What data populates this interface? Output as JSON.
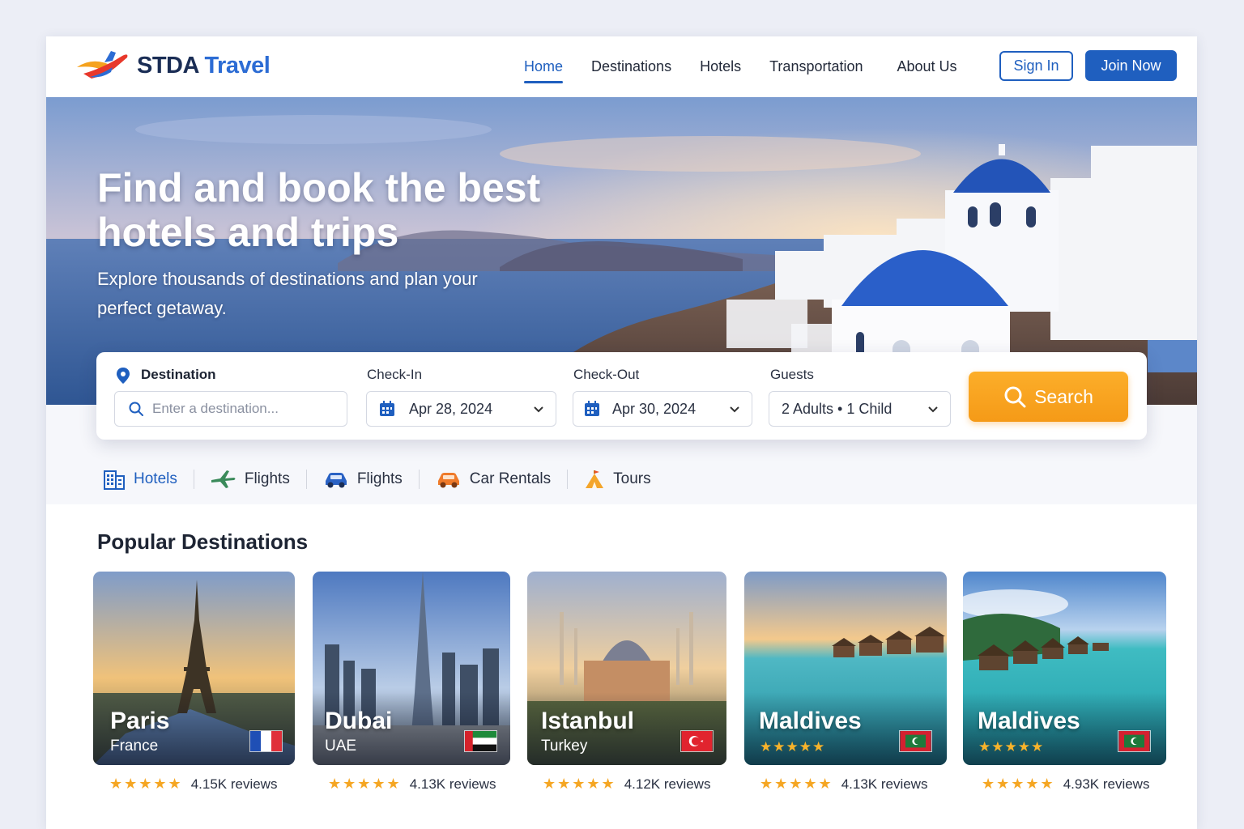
{
  "brand": {
    "name_part1": "STDA",
    "name_part2": "Travel"
  },
  "nav": {
    "items": [
      "Home",
      "Destinations",
      "Hotels",
      "Transportation",
      "About Us"
    ],
    "active": "Home",
    "sign_in": "Sign In",
    "join_now": "Join Now"
  },
  "hero": {
    "title": "Find and book the best hotels and trips",
    "subtitle": "Explore thousands of destinations and plan your perfect getaway."
  },
  "search": {
    "destination_label": "Destination",
    "destination_placeholder": "Enter a destination...",
    "checkin_label": "Check-In",
    "checkin_value": "Apr 28, 2024",
    "checkout_label": "Check-Out",
    "checkout_value": "Apr 30, 2024",
    "guests_label": "Guests",
    "guests_value": "2 Adults • 1 Child",
    "search_button": "Search"
  },
  "categories": [
    {
      "label": "Hotels",
      "icon": "building-icon",
      "active": true
    },
    {
      "label": "Flights",
      "icon": "plane-icon"
    },
    {
      "label": "Flights",
      "icon": "car-icon"
    },
    {
      "label": "Car Rentals",
      "icon": "car-rental-icon"
    },
    {
      "label": "Tours",
      "icon": "tour-tent-icon"
    }
  ],
  "popular": {
    "title": "Popular Destinations",
    "destinations": [
      {
        "name": "Paris",
        "country": "France",
        "flag": "france-flag",
        "rating_stars": 4.5,
        "reviews": "4.15K reviews"
      },
      {
        "name": "Dubai",
        "country": "UAE",
        "flag": "uae-flag",
        "rating_stars": 5,
        "reviews": "4.13K reviews"
      },
      {
        "name": "Istanbul",
        "country": "Turkey",
        "flag": "turkey-flag",
        "rating_stars": 4.5,
        "reviews": "4.12K reviews"
      },
      {
        "name": "Maldives",
        "country": "",
        "flag": "maldives-flag",
        "rating_stars": 4.5,
        "reviews": "4.13K reviews"
      },
      {
        "name": "Maldives",
        "country": "",
        "flag": "maldives-flag",
        "rating_stars": 4.5,
        "reviews": "4.93K reviews"
      }
    ]
  },
  "colors": {
    "primary": "#1f5fbf",
    "accent": "#f7a21e",
    "star": "#f5a623"
  }
}
